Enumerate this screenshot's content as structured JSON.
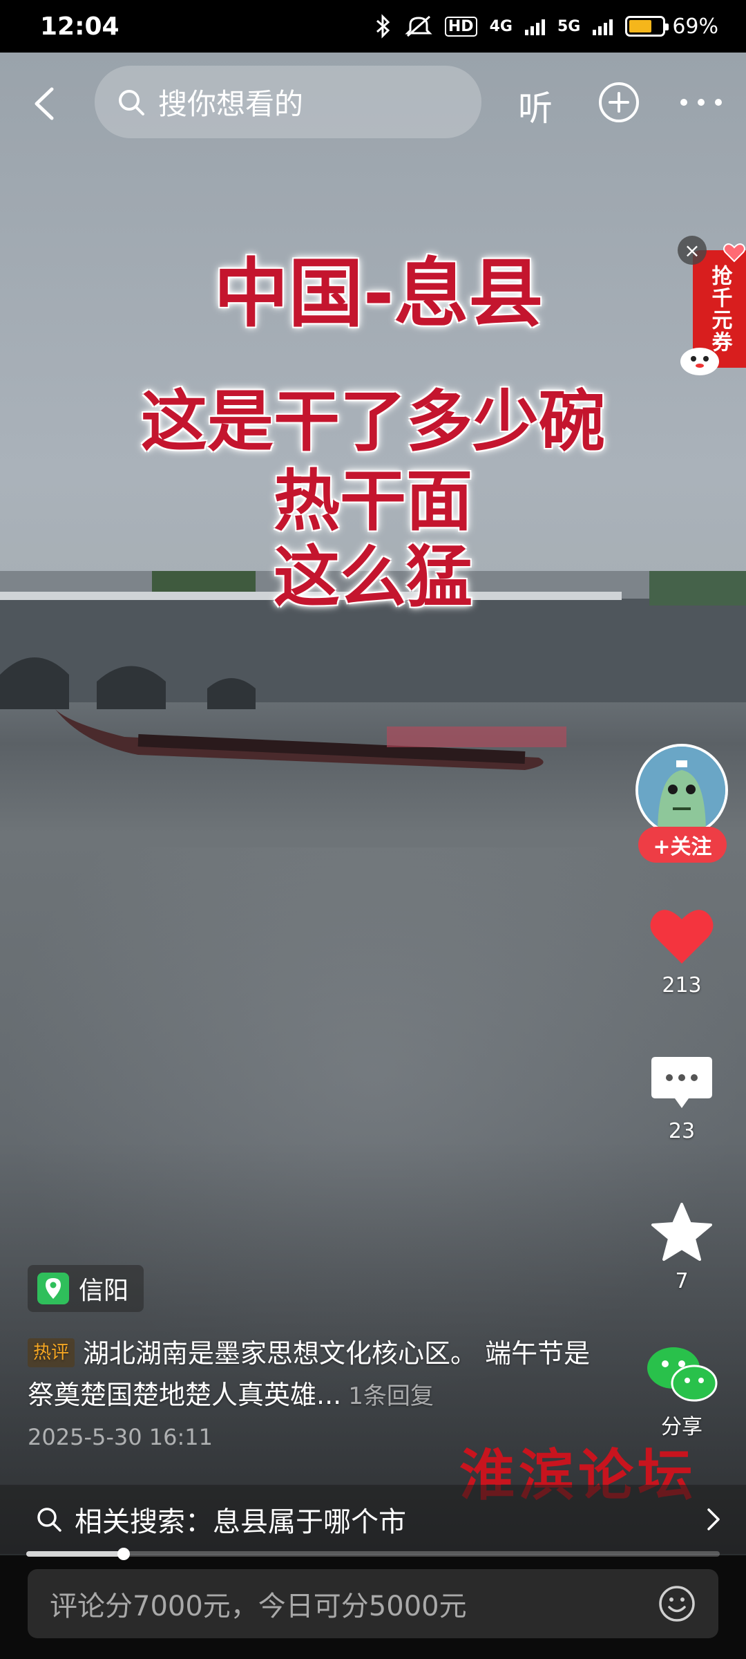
{
  "status_bar": {
    "time": "12:04",
    "hd_label": "HD",
    "net1": "4G",
    "net2": "5G",
    "battery_percent": "69%",
    "battery_level": 0.69
  },
  "top_bar": {
    "search_placeholder": "搜你想看的",
    "listen_label": "听"
  },
  "video_overlay": {
    "title": "中国-息县",
    "lines": [
      "这是干了多少碗",
      "热干面",
      "这么猛"
    ]
  },
  "coupon": {
    "label": "抢千元券",
    "close": "×"
  },
  "creator": {
    "follow_label": "+关注"
  },
  "actions": {
    "like_count": "213",
    "comment_count": "23",
    "favorite_count": "7",
    "share_label": "分享",
    "like_color": "#f4343e",
    "share_color": "#29c14b"
  },
  "location": {
    "label": "信阳"
  },
  "hot_comment": {
    "badge": "热评",
    "text": "湖北湖南是墨家思想文化核心区。 端午节是祭奠楚国楚地楚人真英雄...",
    "replies": "1条回复"
  },
  "post_date": "2025-5-30 16:11",
  "watermark": "淮滨论坛",
  "related_search": {
    "text": "相关搜索：息县属于哪个市"
  },
  "progress": {
    "fraction": 0.14
  },
  "comment_bar": {
    "placeholder": "评论分7000元，今日可分5000元"
  }
}
